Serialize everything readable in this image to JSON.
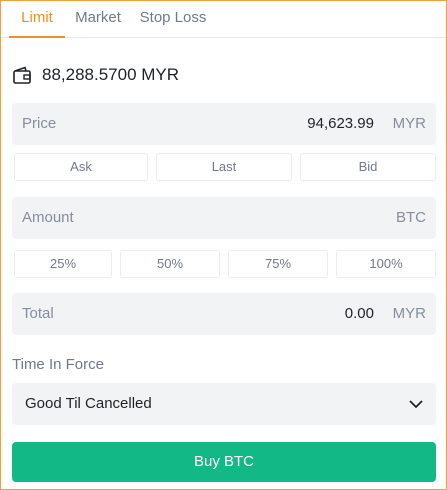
{
  "tabs": [
    {
      "label": "Limit",
      "active": true
    },
    {
      "label": "Market",
      "active": false
    },
    {
      "label": "Stop Loss",
      "active": false
    }
  ],
  "balance": {
    "icon": "wallet-icon",
    "text": "88,288.5700 MYR"
  },
  "price": {
    "label": "Price",
    "value": "94,623.99",
    "unit": "MYR"
  },
  "price_refs": [
    "Ask",
    "Last",
    "Bid"
  ],
  "amount": {
    "label": "Amount",
    "value": "",
    "unit": "BTC"
  },
  "percent_options": [
    "25%",
    "50%",
    "75%",
    "100%"
  ],
  "total": {
    "label": "Total",
    "value": "0.00",
    "unit": "MYR"
  },
  "time_in_force": {
    "label": "Time In Force",
    "selected": "Good Til Cancelled",
    "icon": "chevron-down-icon"
  },
  "submit": {
    "label": "Buy BTC"
  },
  "colors": {
    "accent": "#f0901e",
    "buy": "#12b886",
    "field_bg": "#f2f3f5"
  }
}
